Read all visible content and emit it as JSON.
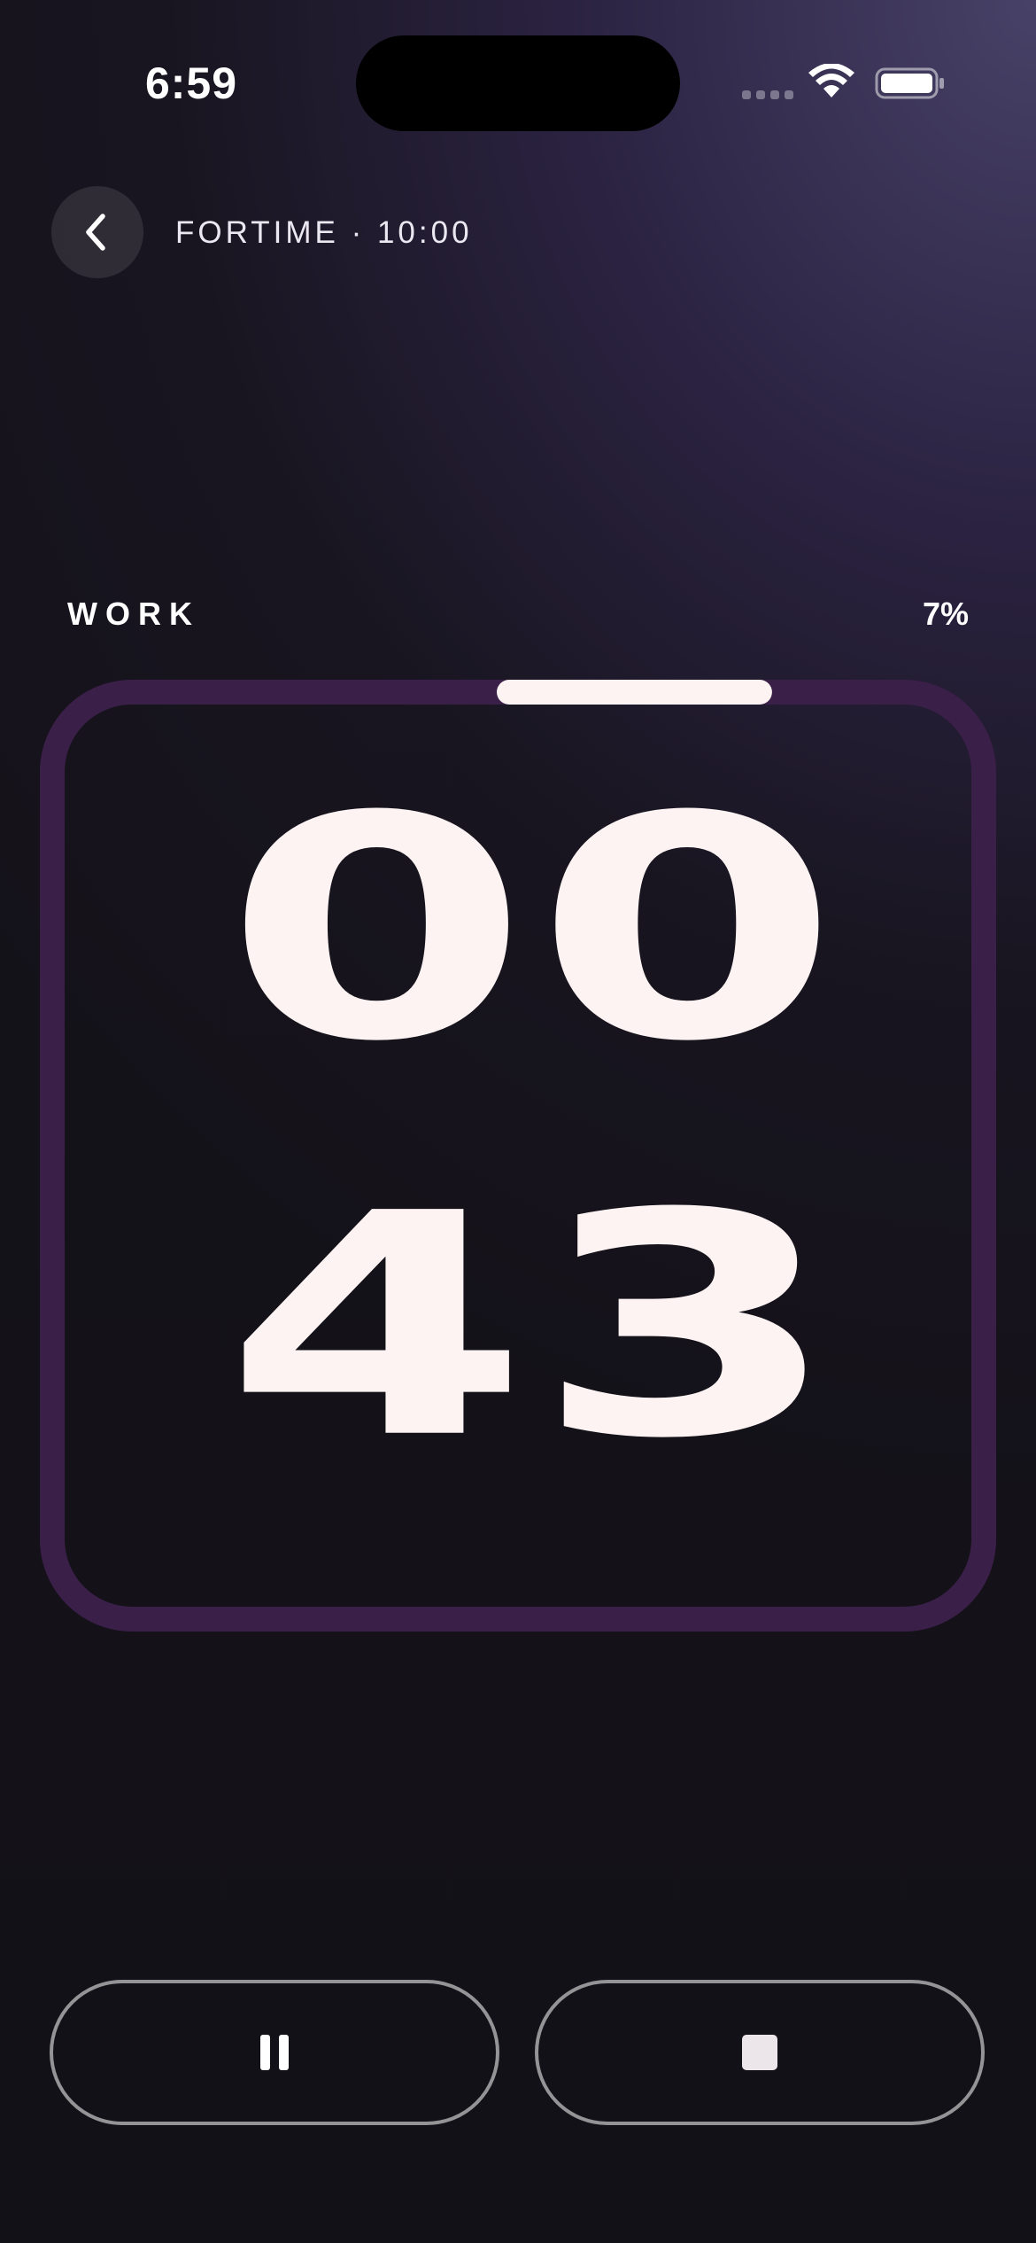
{
  "status_bar": {
    "time": "6:59"
  },
  "header": {
    "title": "FORTIME · 10:00"
  },
  "phase": {
    "label": "WORK",
    "percent_text": "7%",
    "progress": 0.07
  },
  "timer": {
    "minutes": "00",
    "seconds": "43"
  },
  "colors": {
    "digit": "#fdf3f2",
    "ring_track": "#3a1f48",
    "ring_progress": "#fdf3f2",
    "background_accent": "#4a446c"
  },
  "controls": [
    {
      "name": "pause",
      "icon": "pause-icon"
    },
    {
      "name": "stop",
      "icon": "stop-icon"
    }
  ]
}
